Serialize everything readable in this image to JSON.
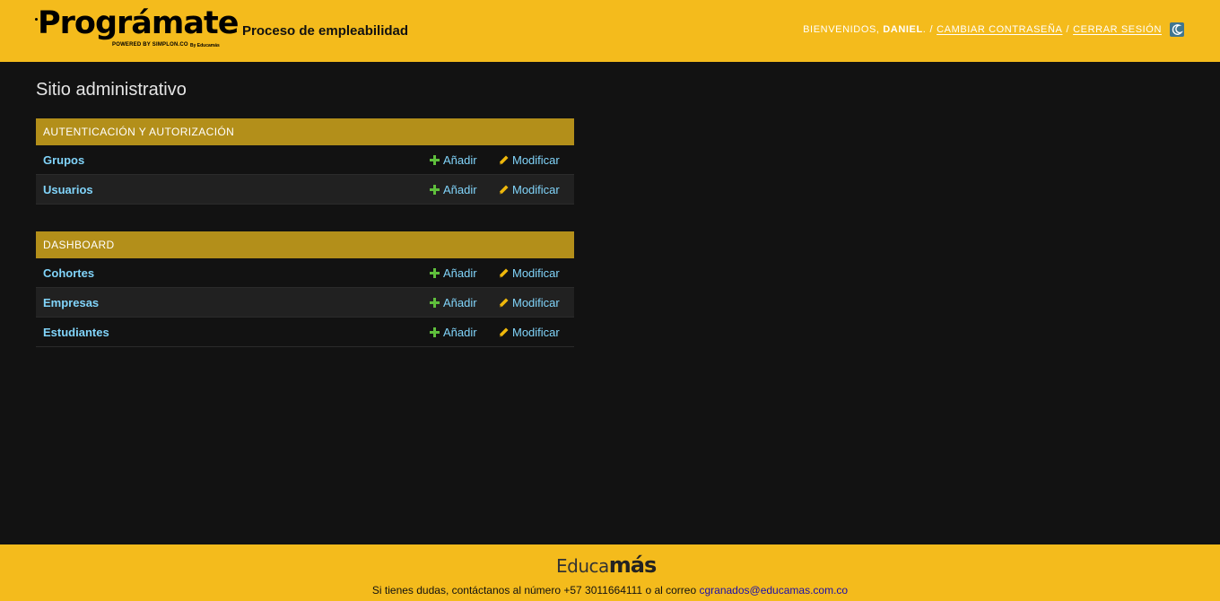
{
  "header": {
    "logo_text": "Prográmate",
    "logo_powered": "POWERED BY SIMPLON.CO",
    "logo_by": "By Educamás",
    "site_title": "Proceso de empleabilidad",
    "welcome": "BIENVENIDOS,",
    "username": "DANIEL",
    "change_password": "CAMBIAR CONTRASEÑA",
    "logout": "CERRAR SESIÓN"
  },
  "main": {
    "title": "Sitio administrativo",
    "add_label": "Añadir",
    "change_label": "Modificar",
    "modules": [
      {
        "caption": "AUTENTICACIÓN Y AUTORIZACIÓN",
        "models": [
          "Grupos",
          "Usuarios"
        ]
      },
      {
        "caption": "DASHBOARD",
        "models": [
          "Cohortes",
          "Empresas",
          "Estudiantes"
        ]
      }
    ]
  },
  "footer": {
    "logo_educa": "Educa",
    "logo_mas": "más",
    "text": "Si tienes dudas, contáctanos al número +57 3011664111 o al correo",
    "email": "cgranados@educamas.com.co"
  },
  "colors": {
    "brand_yellow": "#f4bb1c",
    "module_header": "#b38f1a",
    "link": "#81d4fa",
    "add_icon": "#5fbf3c",
    "change_icon": "#efb80b",
    "background": "#121212"
  },
  "icons": [
    "moon-icon",
    "plus-icon",
    "pencil-icon"
  ]
}
